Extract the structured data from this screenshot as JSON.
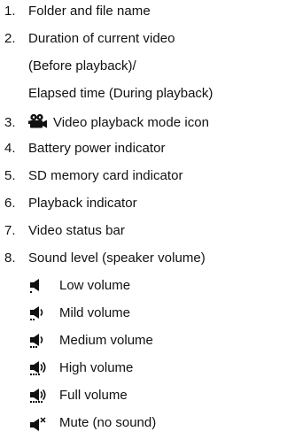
{
  "list": [
    {
      "num": "1.",
      "text": "Folder and file name"
    },
    {
      "num": "2.",
      "text": "Duration of current video",
      "cont": [
        "(Before playback)/",
        "Elapsed time (During playback)"
      ]
    },
    {
      "num": "3.",
      "text": "Video playback mode icon",
      "icon": "video-camera-icon"
    },
    {
      "num": "4.",
      "text": "Battery power indicator"
    },
    {
      "num": "5.",
      "text": "SD memory card indicator"
    },
    {
      "num": "6.",
      "text": "Playback indicator"
    },
    {
      "num": "7.",
      "text": "Video status bar"
    },
    {
      "num": "8.",
      "text": "Sound level (speaker volume)"
    }
  ],
  "volume_levels": [
    {
      "text": "Low volume",
      "icon": "speaker-low-icon",
      "level": 1
    },
    {
      "text": "Mild volume",
      "icon": "speaker-mild-icon",
      "level": 2
    },
    {
      "text": "Medium volume",
      "icon": "speaker-medium-icon",
      "level": 3
    },
    {
      "text": "High volume",
      "icon": "speaker-high-icon",
      "level": 4
    },
    {
      "text": "Full volume",
      "icon": "speaker-full-icon",
      "level": 5
    },
    {
      "text": "Mute (no sound)",
      "icon": "speaker-mute-icon",
      "level": 0
    }
  ]
}
